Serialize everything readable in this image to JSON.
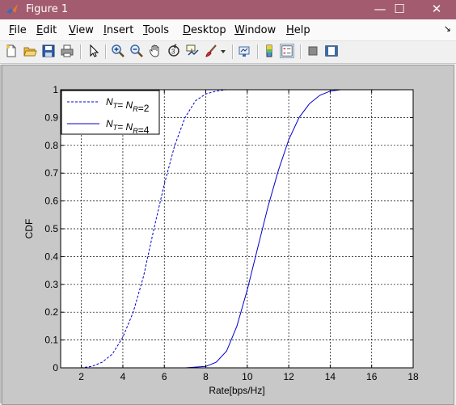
{
  "window": {
    "title": "Figure 1",
    "minimize_glyph": "—",
    "maximize_glyph": "☐",
    "close_glyph": "✕"
  },
  "menu": {
    "items": [
      {
        "key": "F",
        "rest": "ile"
      },
      {
        "key": "E",
        "rest": "dit"
      },
      {
        "key": "V",
        "rest": "iew"
      },
      {
        "key": "I",
        "rest": "nsert"
      },
      {
        "key": "T",
        "rest": "ools"
      },
      {
        "key": "D",
        "rest": "esktop"
      },
      {
        "key": "W",
        "rest": "indow"
      },
      {
        "key": "H",
        "rest": "elp"
      }
    ],
    "dock_glyph": "↘"
  },
  "toolbar": {
    "icons": [
      "new-figure-icon",
      "open-file-icon",
      "save-icon",
      "print-icon",
      "edit-plot-arrow-icon",
      "zoom-in-icon",
      "zoom-out-icon",
      "pan-hand-icon",
      "rotate-3d-icon",
      "data-cursor-icon",
      "brush-icon",
      "dropdown-arrow-icon",
      "link-plot-icon",
      "colorbar-icon",
      "legend-icon",
      "hide-plot-tools-icon",
      "show-plot-tools-icon"
    ]
  },
  "colors": {
    "titlebar": "#a35b6f",
    "figure_bg": "#c8c8c8",
    "series": "#0000cc"
  },
  "chart_data": {
    "type": "line",
    "title": "",
    "xlabel": "Rate[bps/Hz]",
    "ylabel": "CDF",
    "xlim": [
      1,
      18
    ],
    "ylim": [
      0,
      1
    ],
    "xticks": [
      "2",
      "4",
      "6",
      "8",
      "10",
      "12",
      "14",
      "16",
      "18"
    ],
    "yticks": [
      "0",
      "0.1",
      "0.2",
      "0.3",
      "0.4",
      "0.5",
      "0.6",
      "0.7",
      "0.8",
      "0.9",
      "1"
    ],
    "grid": true,
    "legend_position": "top-left",
    "series": [
      {
        "label_main": "N",
        "sub1": "T",
        "mid": "= N",
        "sub2": "R",
        "tail": "=2",
        "style": "dashed",
        "x": [
          1.0,
          2.0,
          2.5,
          3.0,
          3.5,
          4.0,
          4.5,
          5.0,
          5.5,
          6.0,
          6.5,
          7.0,
          7.5,
          8.0,
          8.5,
          9.0,
          9.5,
          10.0
        ],
        "y": [
          0.0,
          0.0,
          0.005,
          0.02,
          0.05,
          0.11,
          0.2,
          0.33,
          0.5,
          0.66,
          0.8,
          0.9,
          0.96,
          0.985,
          0.995,
          1.0,
          1.0,
          1.0
        ]
      },
      {
        "label_main": "N",
        "sub1": "T",
        "mid": "= N",
        "sub2": "R",
        "tail": "=4",
        "style": "solid",
        "x": [
          6.0,
          7.0,
          8.0,
          8.5,
          9.0,
          9.5,
          10.0,
          10.5,
          11.0,
          11.5,
          12.0,
          12.5,
          13.0,
          13.5,
          14.0,
          14.5,
          15.0,
          16.0
        ],
        "y": [
          0.0,
          0.0,
          0.005,
          0.02,
          0.06,
          0.15,
          0.28,
          0.43,
          0.58,
          0.71,
          0.82,
          0.9,
          0.95,
          0.98,
          0.995,
          1.0,
          1.0,
          1.0
        ]
      }
    ]
  }
}
